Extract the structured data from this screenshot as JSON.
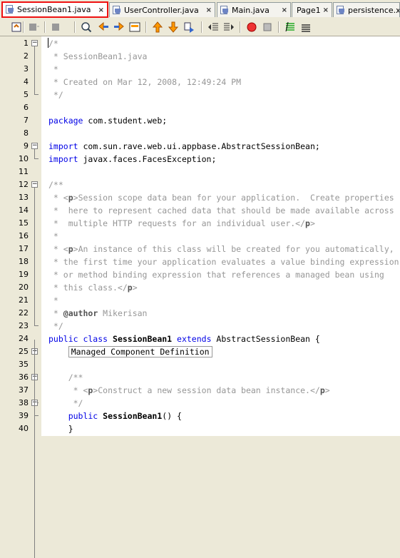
{
  "tabs": [
    {
      "label": "SessionBean1.java",
      "active": true,
      "has_close": true
    },
    {
      "label": "UserController.java",
      "active": false,
      "has_close": true
    },
    {
      "label": "Main.java",
      "active": false,
      "has_close": true
    },
    {
      "label": "Page1",
      "active": false,
      "has_close": true
    },
    {
      "label": "persistence.xml",
      "active": false,
      "has_close": false
    }
  ],
  "close_glyph": "×",
  "toolbar": {
    "buttons": [
      "source-icon",
      "back-icon",
      "forward-icon",
      "find-icon",
      "find-previous-icon",
      "find-next-icon",
      "toggle-highlight-icon",
      "previous-bookmark-icon",
      "next-bookmark-icon",
      "toggle-bookmark-icon",
      "shift-left-icon",
      "shift-right-icon",
      "start-macro-icon",
      "stop-macro-icon",
      "comment-icon",
      "uncomment-icon"
    ]
  },
  "editor": {
    "lines": [
      {
        "n": "1",
        "segs": [
          [
            "cm",
            "/*"
          ]
        ]
      },
      {
        "n": "2",
        "segs": [
          [
            "cm",
            " * SessionBean1.java"
          ]
        ]
      },
      {
        "n": "3",
        "segs": [
          [
            "cm",
            " *"
          ]
        ]
      },
      {
        "n": "4",
        "segs": [
          [
            "cm",
            " * Created on Mar 12, 2008, 12:49:24 PM"
          ]
        ]
      },
      {
        "n": "5",
        "segs": [
          [
            "cm",
            " */"
          ]
        ]
      },
      {
        "n": "6",
        "segs": []
      },
      {
        "n": "7",
        "segs": [
          [
            "kw",
            "package"
          ],
          [
            "",
            " com.student.web;"
          ]
        ]
      },
      {
        "n": "8",
        "segs": []
      },
      {
        "n": "9",
        "segs": [
          [
            "kw",
            "import"
          ],
          [
            "",
            " com.sun.rave.web.ui.appbase.AbstractSessionBean;"
          ]
        ]
      },
      {
        "n": "10",
        "segs": [
          [
            "kw",
            "import"
          ],
          [
            "",
            " javax.faces.FacesException;"
          ]
        ]
      },
      {
        "n": "11",
        "segs": []
      },
      {
        "n": "12",
        "segs": [
          [
            "cm",
            "/**"
          ]
        ]
      },
      {
        "n": "13",
        "segs": [
          [
            "cm",
            " * <"
          ],
          [
            "cmb",
            "p"
          ],
          [
            "cm",
            ">Session scope data bean for your application.  Create properties"
          ]
        ]
      },
      {
        "n": "14",
        "segs": [
          [
            "cm",
            " *  here to represent cached data that should be made available across"
          ]
        ]
      },
      {
        "n": "15",
        "segs": [
          [
            "cm",
            " *  multiple HTTP requests for an individual user.</"
          ],
          [
            "cmb",
            "p"
          ],
          [
            "cm",
            ">"
          ]
        ]
      },
      {
        "n": "16",
        "segs": [
          [
            "cm",
            " *"
          ]
        ]
      },
      {
        "n": "17",
        "segs": [
          [
            "cm",
            " * <"
          ],
          [
            "cmb",
            "p"
          ],
          [
            "cm",
            ">An instance of this class will be created for you automatically,"
          ]
        ]
      },
      {
        "n": "18",
        "segs": [
          [
            "cm",
            " * the first time your application evaluates a value binding expression"
          ]
        ]
      },
      {
        "n": "19",
        "segs": [
          [
            "cm",
            " * or method binding expression that references a managed bean using"
          ]
        ]
      },
      {
        "n": "20",
        "segs": [
          [
            "cm",
            " * this class.</"
          ],
          [
            "cmb",
            "p"
          ],
          [
            "cm",
            ">"
          ]
        ]
      },
      {
        "n": "21",
        "segs": [
          [
            "cm",
            " *"
          ]
        ]
      },
      {
        "n": "22",
        "segs": [
          [
            "cm",
            " * "
          ],
          [
            "cmb",
            "@author"
          ],
          [
            "cm",
            " Mikerisan"
          ]
        ]
      },
      {
        "n": "23",
        "segs": [
          [
            "cm",
            " */"
          ]
        ]
      },
      {
        "n": "24",
        "segs": [
          [
            "kw",
            "public class "
          ],
          [
            "bold",
            "SessionBean1"
          ],
          [
            "kw",
            " extends"
          ],
          [
            "",
            " AbstractSessionBean {"
          ]
        ]
      },
      {
        "n": "25",
        "segs": [
          [
            "",
            "    "
          ],
          [
            "folded",
            "Managed Component Definition"
          ]
        ]
      },
      {
        "n": "35",
        "segs": []
      },
      {
        "n": "36",
        "segs": [
          [
            "cm",
            "    /**"
          ]
        ]
      },
      {
        "n": "37",
        "segs": [
          [
            "cm",
            "     * <"
          ],
          [
            "cmb",
            "p"
          ],
          [
            "cm",
            ">Construct a new session data bean instance.</"
          ],
          [
            "cmb",
            "p"
          ],
          [
            "cm",
            ">"
          ]
        ]
      },
      {
        "n": "38",
        "segs": [
          [
            "cm",
            "     */"
          ]
        ]
      },
      {
        "n": "39",
        "segs": [
          [
            "kw",
            "    public "
          ],
          [
            "bold",
            "SessionBean1"
          ],
          [
            "",
            "() {"
          ]
        ]
      },
      {
        "n": "40",
        "segs": [
          [
            "",
            "    }"
          ]
        ]
      }
    ]
  },
  "colors": {
    "keyword": "#0000e6",
    "comment": "#969696",
    "active_tab_border": "#ee1111"
  }
}
